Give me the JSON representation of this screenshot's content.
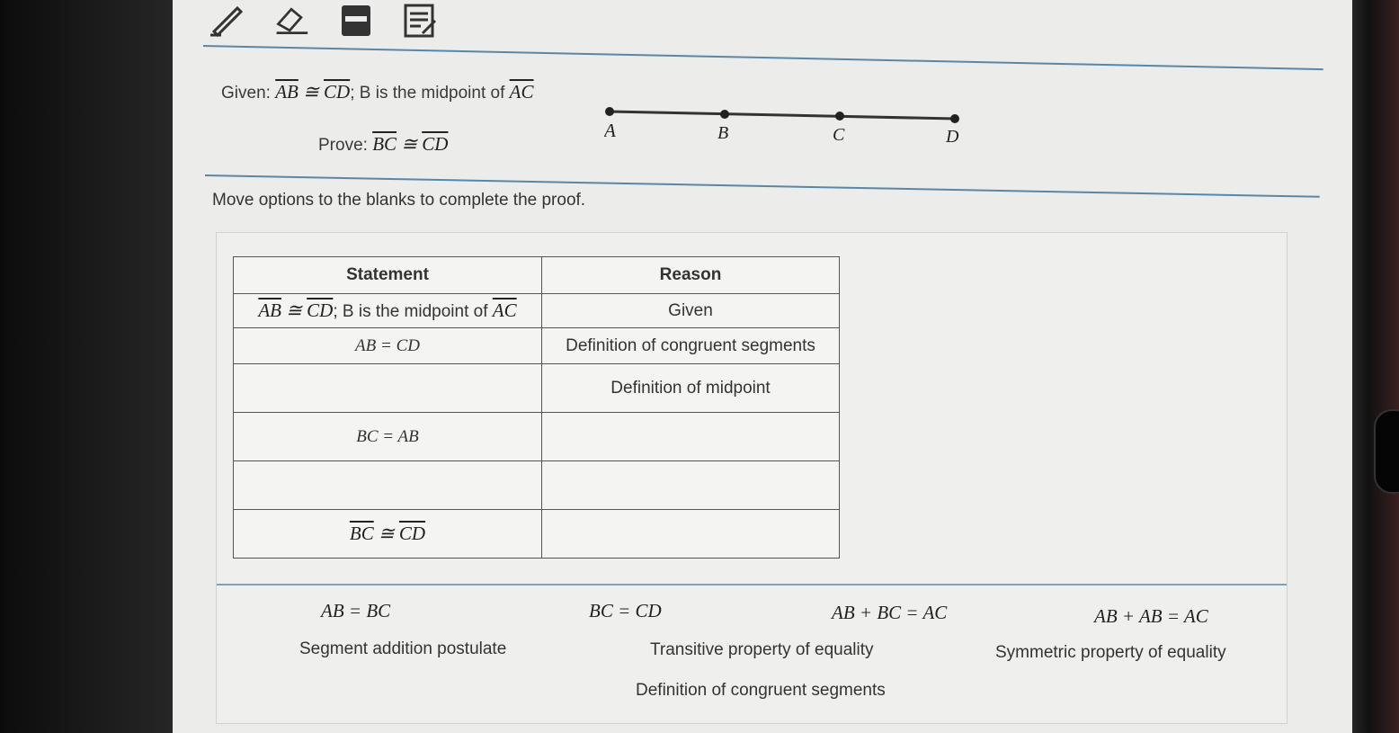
{
  "toolbar": {
    "tools": [
      "pencil-icon",
      "eraser-icon",
      "calculator-icon",
      "notepad-icon"
    ]
  },
  "problem": {
    "given_prefix": "Given:",
    "given_seg1": "AB",
    "congruent": "≅",
    "given_seg2": "CD",
    "given_middle": "; B is the midpoint of",
    "given_seg3": "AC",
    "prove_prefix": "Prove:",
    "prove_seg1": "BC",
    "prove_seg2": "CD",
    "points": [
      "A",
      "B",
      "C",
      "D"
    ]
  },
  "instructions": "Move options to the blanks to complete the proof.",
  "table": {
    "headers": {
      "statement": "Statement",
      "reason": "Reason"
    },
    "rows": [
      {
        "statement": "AB ≅ CD; B is the midpoint of AC",
        "reason": "Given"
      },
      {
        "statement": "AB = CD",
        "reason": "Definition of congruent segments"
      },
      {
        "statement": "",
        "reason": "Definition of midpoint"
      },
      {
        "statement": "BC = AB",
        "reason": ""
      },
      {
        "statement": "",
        "reason": ""
      },
      {
        "statement": "BC ≅ CD",
        "reason": ""
      }
    ]
  },
  "options": {
    "eq1": "AB = BC",
    "eq2": "BC = CD",
    "eq3": "AB + BC = AC",
    "eq4": "AB + AB = AC",
    "reason1": "Segment addition postulate",
    "reason2": "Transitive property of equality",
    "reason3": "Symmetric property of equality",
    "reason4": "Definition of congruent segments"
  },
  "colors": {
    "divider": "#5b87a4",
    "background": "#ececeb"
  }
}
